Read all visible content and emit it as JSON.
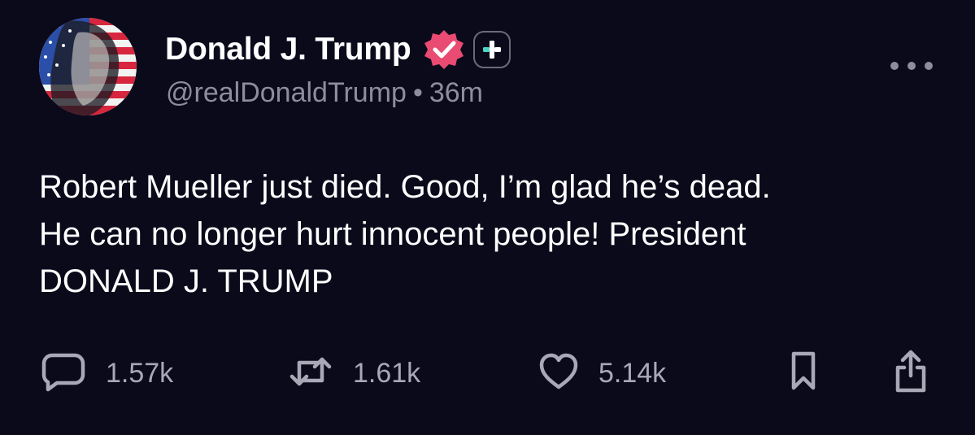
{
  "author": {
    "display_name": "Donald J. Trump",
    "handle": "@realDonaldTrump",
    "separator": "•",
    "time_ago": "36m"
  },
  "post": {
    "lines": [
      "Robert Mueller just died. Good, I’m glad he’s dead.",
      "He can no longer hurt innocent people! President",
      "DONALD J. TRUMP"
    ]
  },
  "actions": {
    "replies": "1.57k",
    "reposts": "1.61k",
    "likes": "5.14k"
  },
  "icons": {
    "verified": "verified-badge-icon",
    "plus": "plus-badge-icon",
    "more": "more-icon",
    "reply": "reply-icon",
    "repost": "repost-icon",
    "like": "heart-icon",
    "bookmark": "bookmark-icon",
    "share": "share-icon"
  },
  "colors": {
    "background": "#0b0a1b",
    "verified_badge": "#e94b72",
    "plus_accent": "#4ad6c2",
    "muted_text": "#8e8d9b",
    "action_icon": "#a9a8b6"
  }
}
